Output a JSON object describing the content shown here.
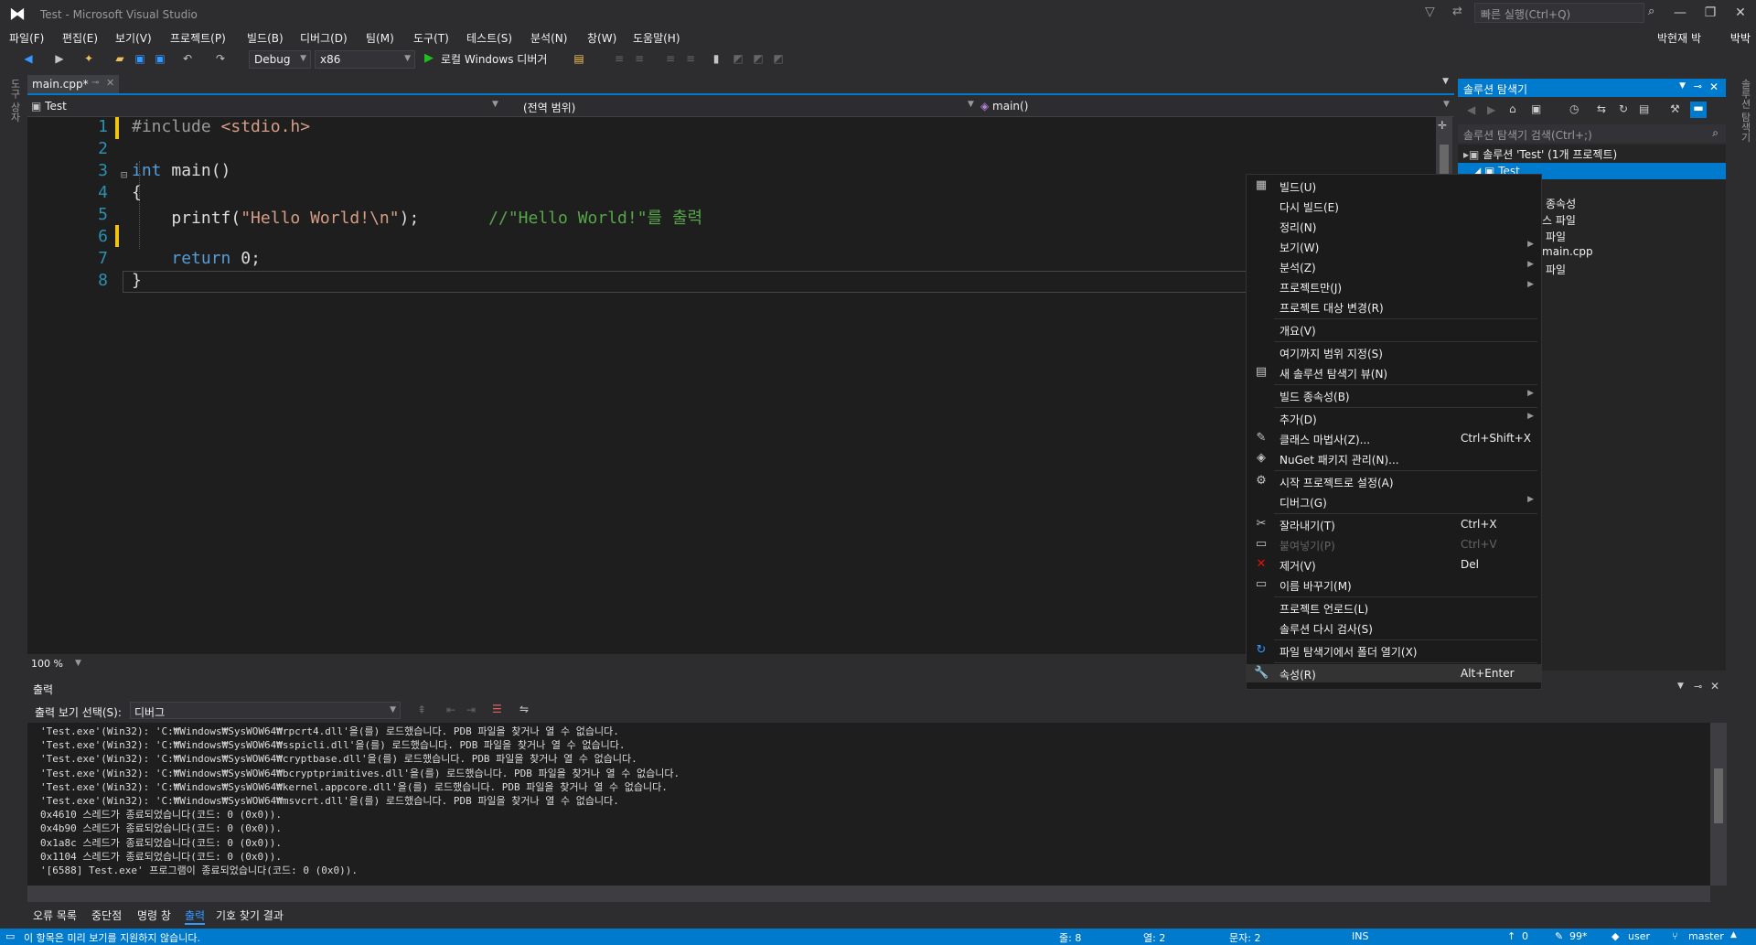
{
  "window": {
    "title": "Test - Microsoft Visual Studio",
    "quick_launch": "빠른 실행(Ctrl+Q)",
    "user": "박현재 박",
    "user_badge": "박박"
  },
  "menu": [
    "파일(F)",
    "편집(E)",
    "보기(V)",
    "프로젝트(P)",
    "빌드(B)",
    "디버그(D)",
    "팀(M)",
    "도구(T)",
    "테스트(S)",
    "분석(N)",
    "창(W)",
    "도움말(H)"
  ],
  "toolbar": {
    "config": "Debug",
    "platform": "x86",
    "run": "로컬 Windows 디버거"
  },
  "left_strip": [
    "도구 상자"
  ],
  "editor": {
    "tab": "main.cpp*",
    "nav_project": "Test",
    "nav_scope": "(전역 범위)",
    "nav_member": "main()",
    "zoom": "100 %",
    "line_numbers": [
      "1",
      "2",
      "3",
      "4",
      "5",
      "6",
      "7",
      "8"
    ],
    "lines": [
      [
        {
          "t": "#include ",
          "c": "pp"
        },
        {
          "t": "<stdio.h>",
          "c": "inc"
        }
      ],
      [],
      [
        {
          "t": "int",
          "c": "kw"
        },
        {
          "t": " main()",
          "c": ""
        }
      ],
      [
        {
          "t": "{",
          "c": ""
        }
      ],
      [
        {
          "t": "    printf(",
          "c": ""
        },
        {
          "t": "\"Hello World!\\n\"",
          "c": "str"
        },
        {
          "t": ");       ",
          "c": ""
        },
        {
          "t": "//\"Hello World!\"를 출력",
          "c": "cm"
        }
      ],
      [],
      [
        {
          "t": "    ",
          "c": ""
        },
        {
          "t": "return",
          "c": "kw"
        },
        {
          "t": " 0;",
          "c": ""
        }
      ],
      [
        {
          "t": "}",
          "c": ""
        }
      ]
    ]
  },
  "output": {
    "title": "출력",
    "source_label": "출력 보기 선택(S):",
    "source_value": "디버그",
    "lines": [
      "'Test.exe'(Win32): 'C:₩Windows₩SysWOW64₩rpcrt4.dll'을(를) 로드했습니다. PDB 파일을 찾거나 열 수 없습니다.",
      "'Test.exe'(Win32): 'C:₩Windows₩SysWOW64₩sspicli.dll'을(를) 로드했습니다. PDB 파일을 찾거나 열 수 없습니다.",
      "'Test.exe'(Win32): 'C:₩Windows₩SysWOW64₩cryptbase.dll'을(를) 로드했습니다. PDB 파일을 찾거나 열 수 없습니다.",
      "'Test.exe'(Win32): 'C:₩Windows₩SysWOW64₩bcryptprimitives.dll'을(를) 로드했습니다. PDB 파일을 찾거나 열 수 없습니다.",
      "'Test.exe'(Win32): 'C:₩Windows₩SysWOW64₩kernel.appcore.dll'을(를) 로드했습니다. PDB 파일을 찾거나 열 수 없습니다.",
      "'Test.exe'(Win32): 'C:₩Windows₩SysWOW64₩msvcrt.dll'을(를) 로드했습니다. PDB 파일을 찾거나 열 수 없습니다.",
      "0x4610 스레드가 종료되었습니다(코드: 0 (0x0)).",
      "0x4b90 스레드가 종료되었습니다(코드: 0 (0x0)).",
      "0x1a8c 스레드가 종료되었습니다(코드: 0 (0x0)).",
      "0x1104 스레드가 종료되었습니다(코드: 0 (0x0)).",
      "'[6588] Test.exe' 프로그램이 종료되었습니다(코드: 0 (0x0))."
    ]
  },
  "bottom_tabs": [
    "오류 목록",
    "중단점",
    "명령 창",
    "출력",
    "기호 찾기 결과"
  ],
  "bottom_tab_active": 3,
  "status": {
    "message": "이 항목은 미리 보기를 지원하지 않습니다.",
    "line": "줄: 8",
    "col": "열: 2",
    "ch": "문자: 2",
    "ins": "INS",
    "up": "0",
    "pencil": "99*",
    "user": "user",
    "branch": "master"
  },
  "solution_explorer": {
    "title": "솔루션 탐색기",
    "search": "솔루션 탐색기 검색(Ctrl+;)",
    "solution": "솔루션 'Test' (1개 프로젝트)",
    "project": "Test",
    "children": [
      "종속성",
      "스 파일",
      "파일",
      "main.cpp",
      "파일"
    ]
  },
  "context_menu": [
    {
      "label": "빌드(U)",
      "icon": "build-icon",
      "glyph": "▦"
    },
    {
      "label": "다시 빌드(E)"
    },
    {
      "label": "정리(N)"
    },
    {
      "label": "보기(W)",
      "submenu": true
    },
    {
      "label": "분석(Z)",
      "submenu": true
    },
    {
      "label": "프로젝트만(J)",
      "submenu": true
    },
    {
      "label": "프로젝트 대상 변경(R)",
      "sep_after": true
    },
    {
      "label": "개요(V)",
      "sep_after": true
    },
    {
      "label": "여기까지 범위 지정(S)"
    },
    {
      "label": "새 솔루션 탐색기 뷰(N)",
      "icon": "new-view-icon",
      "glyph": "▤",
      "sep_after": true
    },
    {
      "label": "빌드 종속성(B)",
      "submenu": true,
      "sep_after": true
    },
    {
      "label": "추가(D)",
      "submenu": true
    },
    {
      "label": "클래스 마법사(Z)...",
      "shortcut": "Ctrl+Shift+X",
      "icon": "class-wizard-icon",
      "glyph": "✎"
    },
    {
      "label": "NuGet 패키지 관리(N)...",
      "icon": "nuget-icon",
      "glyph": "◈",
      "sep_after": true
    },
    {
      "label": "시작 프로젝트로 설정(A)",
      "icon": "gear-icon",
      "glyph": "⚙"
    },
    {
      "label": "디버그(G)",
      "submenu": true,
      "sep_after": true
    },
    {
      "label": "잘라내기(T)",
      "shortcut": "Ctrl+X",
      "icon": "scissors-icon",
      "glyph": "✂"
    },
    {
      "label": "붙여넣기(P)",
      "shortcut": "Ctrl+V",
      "icon": "paste-icon",
      "glyph": "▭",
      "disabled": true
    },
    {
      "label": "제거(V)",
      "shortcut": "Del",
      "icon": "delete-icon",
      "glyph": "✕",
      "red": true
    },
    {
      "label": "이름 바꾸기(M)",
      "icon": "rename-icon",
      "glyph": "▭",
      "sep_after": true
    },
    {
      "label": "프로젝트 언로드(L)"
    },
    {
      "label": "솔루션 다시 검사(S)",
      "sep_after": true
    },
    {
      "label": "파일 탐색기에서 폴더 열기(X)",
      "icon": "refresh-icon",
      "glyph": "↻",
      "sep_after": true
    },
    {
      "label": "속성(R)",
      "shortcut": "Alt+Enter",
      "icon": "wrench-icon",
      "glyph": "🔧",
      "highlight": true
    }
  ]
}
